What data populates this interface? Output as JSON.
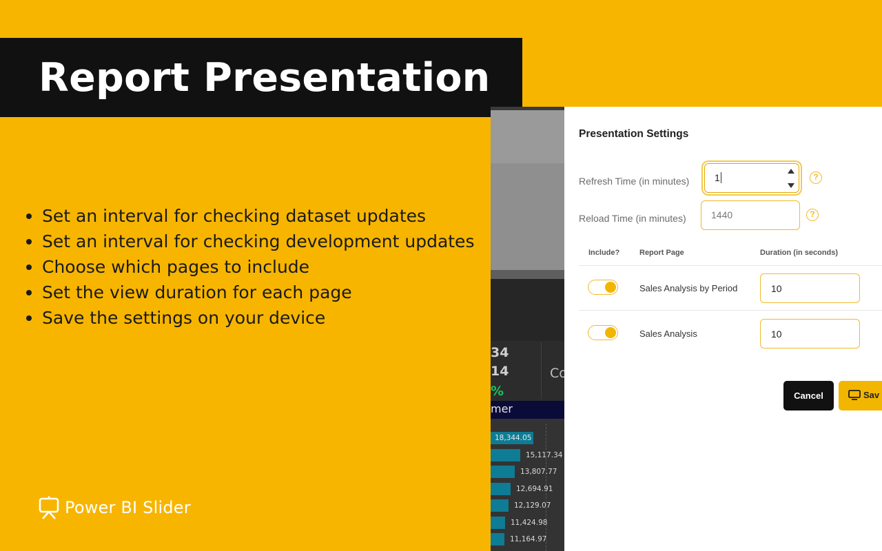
{
  "hero": {
    "title": "Report Presentation",
    "bullets": [
      "Set an interval for checking dataset updates",
      "Set an interval for checking development updates",
      "Choose which pages to include",
      "Set the view duration for each page",
      "Save the settings on your device"
    ]
  },
  "brand": {
    "name": "Power BI Slider",
    "icon": "presentation-board-icon"
  },
  "colors": {
    "background": "#F7B500",
    "title_bar": "#111111",
    "accent": "#F2B600"
  },
  "report_bg": {
    "kpi_values": [
      "34",
      "14",
      "%"
    ],
    "kpi_label": "Co",
    "band_label": "mer",
    "bars": [
      {
        "label": "18,344.05",
        "fraction": 1.0
      },
      {
        "label": "15,117.34",
        "fraction": 0.82
      },
      {
        "label": "13,807.77",
        "fraction": 0.75
      },
      {
        "label": "12,694.91",
        "fraction": 0.69
      },
      {
        "label": "12,129.07",
        "fraction": 0.66
      },
      {
        "label": "11,424.98",
        "fraction": 0.62
      },
      {
        "label": "11,164.97",
        "fraction": 0.61
      }
    ]
  },
  "settings": {
    "title": "Presentation Settings",
    "refresh": {
      "label": "Refresh Time (in minutes)",
      "value": "1"
    },
    "reload": {
      "label": "Reload Time (in minutes)",
      "placeholder": "1440"
    },
    "help_glyph": "?",
    "table": {
      "headers": [
        "Include?",
        "Report Page",
        "Duration (in seconds)"
      ],
      "rows": [
        {
          "include": true,
          "page": "Sales Analysis by Period",
          "duration": "10"
        },
        {
          "include": true,
          "page": "Sales Analysis",
          "duration": "10"
        }
      ]
    },
    "cancel_label": "Cancel",
    "save_label": "Sav"
  }
}
